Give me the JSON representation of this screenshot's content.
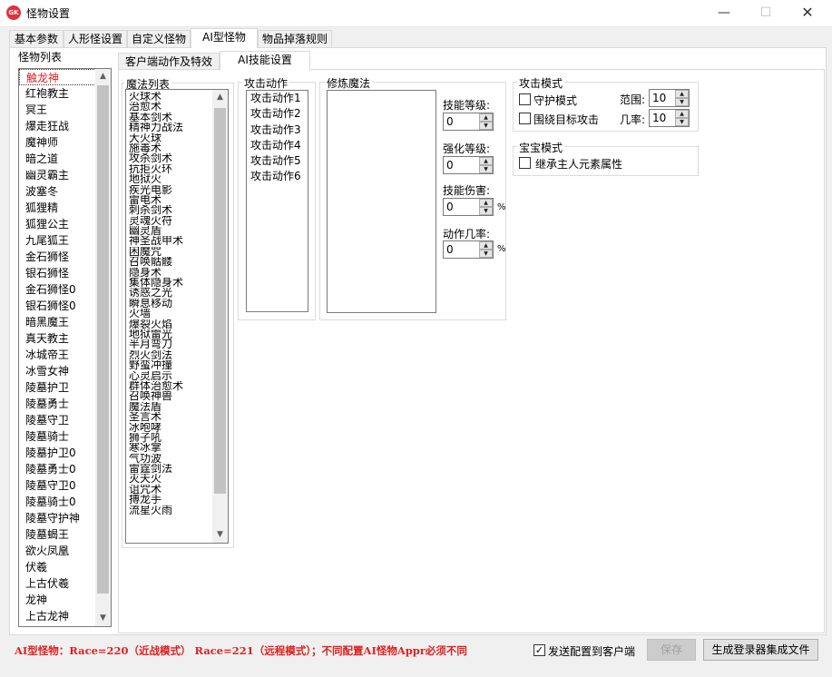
{
  "window": {
    "title": "怪物设置",
    "app_icon_text": "GK",
    "minimize": "—",
    "maximize": "☐",
    "close": "✕"
  },
  "tabs": [
    "基本参数",
    "人形怪设置",
    "自定义怪物",
    "AI型怪物",
    "物品掉落规则"
  ],
  "sub_tabs": [
    "客户端动作及特效",
    "AI技能设置"
  ],
  "monster_list": {
    "label": "怪物列表",
    "selected_index": 0,
    "items": [
      "触龙神",
      "红袍教主",
      "冥王",
      "爆走狂战",
      "魔神师",
      "暗之道",
      "幽灵霸主",
      "波塞冬",
      "狐狸精",
      "狐狸公主",
      "九尾狐王",
      "金石狮怪",
      "银石狮怪",
      "金石狮怪0",
      "银石狮怪0",
      "暗黑魔王",
      "真天教主",
      "冰城帝王",
      "冰雪女神",
      "陵墓护卫",
      "陵墓勇士",
      "陵墓守卫",
      "陵墓骑士",
      "陵墓护卫0",
      "陵墓勇士0",
      "陵墓守卫0",
      "陵墓骑士0",
      "陵墓守护神",
      "陵墓蝎王",
      "欲火凤凰",
      "伏羲",
      "上古伏羲",
      "龙神",
      "上古龙神"
    ]
  },
  "magic_list": {
    "label": "魔法列表",
    "items": [
      "火球术",
      "治愈术",
      "基本剑术",
      "精神力战法",
      "大火球",
      "施毒术",
      "攻杀剑术",
      "抗拒火环",
      "地狱火",
      "疾光电影",
      "雷电术",
      "刺杀剑术",
      "灵魂火符",
      "幽灵盾",
      "神圣战甲术",
      "困魔咒",
      "召唤骷髅",
      "隐身术",
      "集体隐身术",
      "诱惑之光",
      "瞬息移动",
      "火墙",
      "爆裂火焰",
      "地狱雷光",
      "半月弯刀",
      "烈火剑法",
      "野蛮冲撞",
      "心灵启示",
      "群体治愈术",
      "召唤神兽",
      "魔法盾",
      "圣言术",
      "冰咆哮",
      "狮子吼",
      "寒冰掌",
      "气功波",
      "雷霆剑法",
      "灭天火",
      "诅咒术",
      "搏龙手",
      "流星火雨"
    ]
  },
  "attack_actions": {
    "label": "攻击动作",
    "items": [
      "攻击动作1",
      "攻击动作2",
      "攻击动作3",
      "攻击动作4",
      "攻击动作5",
      "攻击动作6"
    ]
  },
  "training_magic": {
    "label": "修炼魔法",
    "skill_level_label": "技能等级:",
    "skill_level": "0",
    "enhance_level_label": "强化等级:",
    "enhance_level": "0",
    "skill_damage_label": "技能伤害:",
    "skill_damage": "0",
    "action_chance_label": "动作几率:",
    "action_chance": "0",
    "percent": "%"
  },
  "attack_mode": {
    "label": "攻击模式",
    "guard_label": "守护模式",
    "guard_checked": false,
    "surround_label": "围绕目标攻击",
    "surround_checked": false,
    "range_label": "范围:",
    "range": "10",
    "chance_label": "几率:",
    "chance": "10"
  },
  "pet_mode": {
    "label": "宝宝模式",
    "inherit_label": "继承主人元素属性",
    "inherit_checked": false
  },
  "footer": {
    "note": "AI型怪物：Race=220（近战模式） Race=221（远程模式）；不同配置AI怪物Appr必须不同",
    "send_to_client_label": "发送配置到客户端",
    "send_to_client_checked": true,
    "save_label": "保存",
    "generate_label": "生成登录器集成文件"
  },
  "colors": {
    "accent_red": "#e02020",
    "window_bg": "#f0f0f0"
  }
}
